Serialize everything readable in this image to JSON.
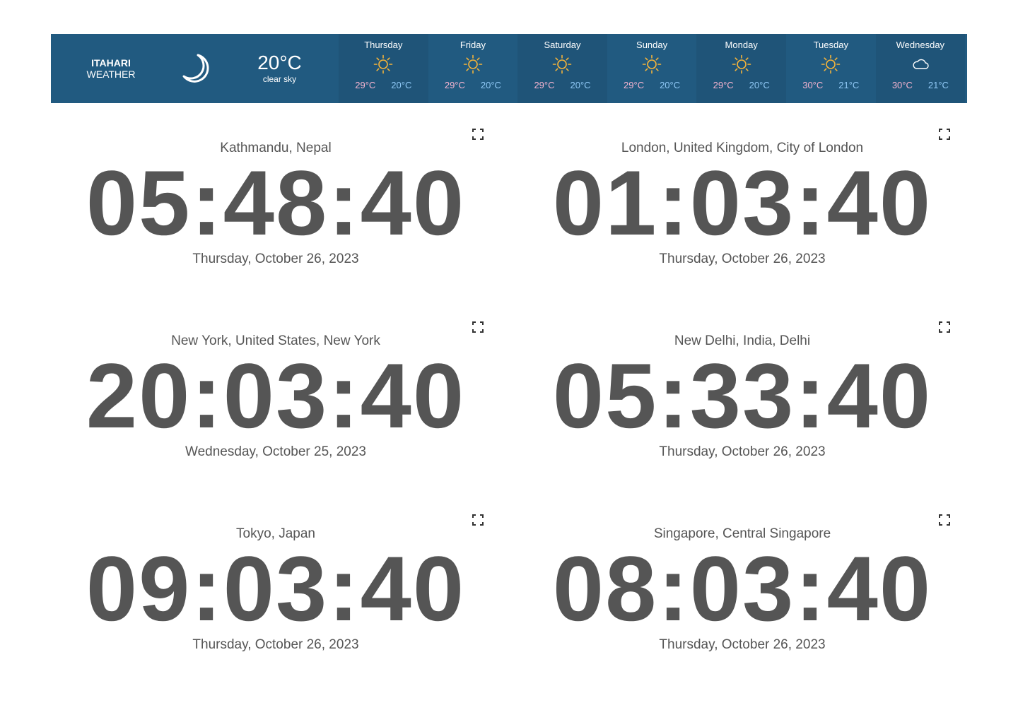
{
  "weather": {
    "city": "ITAHARI",
    "label": "WEATHER",
    "current_icon": "moon-icon",
    "current_temp": "20°C",
    "current_desc": "clear sky",
    "forecast": [
      {
        "day": "Thursday",
        "icon": "sun-icon",
        "high": "29°C",
        "low": "20°C"
      },
      {
        "day": "Friday",
        "icon": "sun-icon",
        "high": "29°C",
        "low": "20°C"
      },
      {
        "day": "Saturday",
        "icon": "sun-icon",
        "high": "29°C",
        "low": "20°C"
      },
      {
        "day": "Sunday",
        "icon": "sun-icon",
        "high": "29°C",
        "low": "20°C"
      },
      {
        "day": "Monday",
        "icon": "sun-icon",
        "high": "29°C",
        "low": "20°C"
      },
      {
        "day": "Tuesday",
        "icon": "sun-icon",
        "high": "30°C",
        "low": "21°C"
      },
      {
        "day": "Wednesday",
        "icon": "cloud-icon",
        "high": "30°C",
        "low": "21°C"
      }
    ],
    "colors": {
      "bar": "#215a80",
      "high": "#f3b3cf",
      "low": "#8fc8f5",
      "sun": "#f5b43a"
    }
  },
  "clocks": [
    {
      "location": "Kathmandu, Nepal",
      "time": "05:48:40",
      "date": "Thursday, October 26, 2023"
    },
    {
      "location": "London, United Kingdom, City of London",
      "time": "01:03:40",
      "date": "Thursday, October 26, 2023"
    },
    {
      "location": "New York, United States, New York",
      "time": "20:03:40",
      "date": "Wednesday, October 25, 2023"
    },
    {
      "location": "New Delhi, India, Delhi",
      "time": "05:33:40",
      "date": "Thursday, October 26, 2023"
    },
    {
      "location": "Tokyo, Japan",
      "time": "09:03:40",
      "date": "Thursday, October 26, 2023"
    },
    {
      "location": "Singapore, Central Singapore",
      "time": "08:03:40",
      "date": "Thursday, October 26, 2023"
    }
  ]
}
